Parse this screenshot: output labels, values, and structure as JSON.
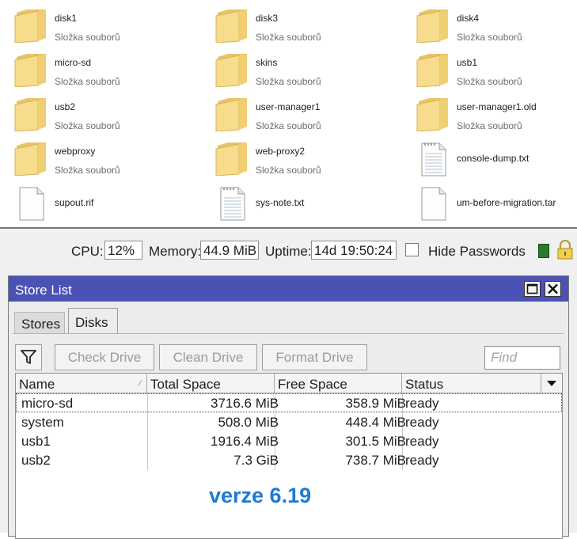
{
  "explorer": {
    "items": [
      {
        "name": "disk1",
        "type": "Složka souborů",
        "kind": "folder"
      },
      {
        "name": "disk3",
        "type": "Složka souborů",
        "kind": "folder"
      },
      {
        "name": "disk4",
        "type": "Složka souborů",
        "kind": "folder"
      },
      {
        "name": "micro-sd",
        "type": "Složka souborů",
        "kind": "folder"
      },
      {
        "name": "skins",
        "type": "Složka souborů",
        "kind": "folder"
      },
      {
        "name": "usb1",
        "type": "Složka souborů",
        "kind": "folder"
      },
      {
        "name": "usb2",
        "type": "Složka souborů",
        "kind": "folder"
      },
      {
        "name": "user-manager1",
        "type": "Složka souborů",
        "kind": "folder"
      },
      {
        "name": "user-manager1.old",
        "type": "Složka souborů",
        "kind": "folder"
      },
      {
        "name": "webproxy",
        "type": "Složka souborů",
        "kind": "folder"
      },
      {
        "name": "web-proxy2",
        "type": "Složka souborů",
        "kind": "folder"
      },
      {
        "name": "console-dump.txt",
        "type": "",
        "kind": "text-file"
      },
      {
        "name": "supout.rif",
        "type": "",
        "kind": "file"
      },
      {
        "name": "sys-note.txt",
        "type": "",
        "kind": "text-file"
      },
      {
        "name": "um-before-migration.tar",
        "type": "",
        "kind": "file"
      }
    ]
  },
  "statusbar": {
    "cpu_label": "CPU:",
    "cpu_value": "12%",
    "memory_label": "Memory:",
    "memory_value": "44.9 MiB",
    "uptime_label": "Uptime:",
    "uptime_value": "14d 19:50:24",
    "hide_passwords_label": "Hide Passwords",
    "hide_passwords_checked": false,
    "icons": [
      "safe-mode-indicator-icon",
      "lock-icon"
    ]
  },
  "window": {
    "title": "Store List",
    "tabs": [
      {
        "label": "Stores",
        "active": false
      },
      {
        "label": "Disks",
        "active": true
      }
    ],
    "toolbar": {
      "filter_icon": "filter-funnel-icon",
      "check_drive_label": "Check Drive",
      "clean_drive_label": "Clean Drive",
      "format_drive_label": "Format Drive",
      "find_placeholder": "Find"
    },
    "table": {
      "columns": [
        "Name",
        "Total Space",
        "Free Space",
        "Status"
      ],
      "rows": [
        {
          "name": "micro-sd",
          "total": "3716.6 MiB",
          "free": "358.9 MiB",
          "status": "ready"
        },
        {
          "name": "system",
          "total": "508.0 MiB",
          "free": "448.4 MiB",
          "status": "ready"
        },
        {
          "name": "usb1",
          "total": "1916.4 MiB",
          "free": "301.5 MiB",
          "status": "ready"
        },
        {
          "name": "usb2",
          "total": "7.3 GiB",
          "free": "738.7 MiB",
          "status": "ready"
        }
      ]
    }
  },
  "overlay": {
    "version_label": "verze 6.19"
  },
  "colors": {
    "titlebar": "#4b52b4",
    "version_text": "#1e7ad7",
    "folder_yellow": "#f2d377"
  }
}
